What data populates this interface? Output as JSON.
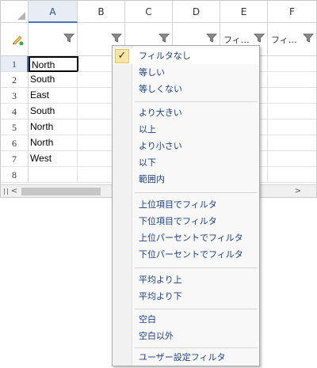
{
  "grid": {
    "columns": [
      "A",
      "B",
      "C",
      "D",
      "E",
      "F"
    ],
    "filter_texts": [
      "",
      "",
      "",
      "",
      "フィ…",
      "フィ…"
    ],
    "rows": [
      "1",
      "2",
      "3",
      "4",
      "5",
      "6",
      "7",
      "8"
    ],
    "colA": [
      "North",
      "South",
      "East",
      "South",
      "North",
      "North",
      "West",
      ""
    ],
    "active_column": "A",
    "active_row": "1"
  },
  "menu": {
    "items": [
      {
        "label": "フィルタなし",
        "checked": true
      },
      {
        "label": "等しい"
      },
      {
        "label": "等しくない"
      },
      {
        "label": "より大きい"
      },
      {
        "label": "以上"
      },
      {
        "label": "より小さい"
      },
      {
        "label": "以下"
      },
      {
        "label": "範囲内"
      },
      {
        "label": "上位項目でフィルタ"
      },
      {
        "label": "下位項目でフィルタ"
      },
      {
        "label": "上位パーセントでフィルタ"
      },
      {
        "label": "下位パーセントでフィルタ"
      },
      {
        "label": "平均より上"
      },
      {
        "label": "平均より下"
      },
      {
        "label": "空白"
      },
      {
        "label": "空白以外"
      },
      {
        "label": "ユーザー設定フィルタ"
      }
    ],
    "check_mark": "✓"
  },
  "scrollbar": {
    "left_arrow": "<",
    "right_arrow": ">"
  },
  "colors": {
    "accent": "#4674c1",
    "menu_text": "#1a3f8a",
    "check_bg": "#fbe5a5"
  }
}
